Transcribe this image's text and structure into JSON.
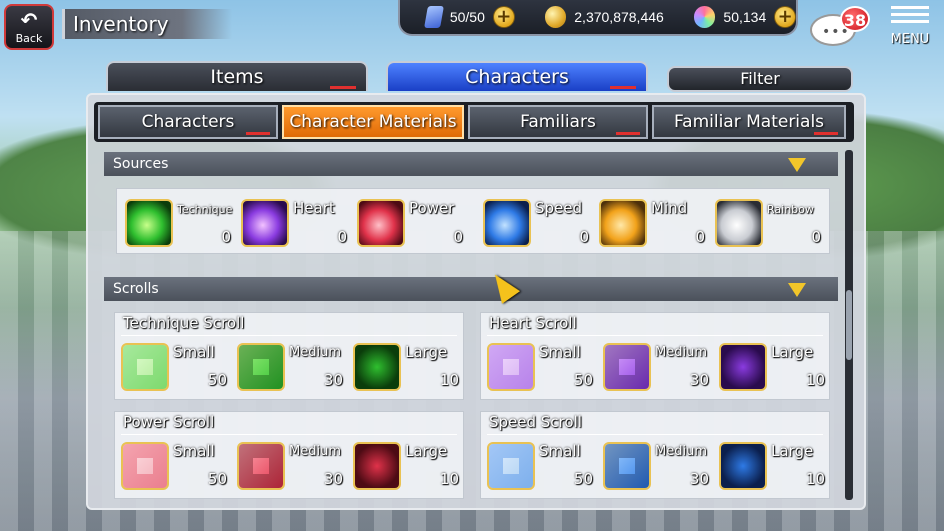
{
  "header": {
    "back_label": "Back",
    "title": "Inventory"
  },
  "resources": {
    "stamina": "50/50",
    "coins": "2,370,878,446",
    "gems": "50,134",
    "plus": "+"
  },
  "chat": {
    "badge": "38"
  },
  "menu_label": "MENU",
  "main_tabs": [
    {
      "label": "Items"
    },
    {
      "label": "Characters"
    }
  ],
  "filter_label": "Filter",
  "sub_tabs": [
    {
      "label": "Characters"
    },
    {
      "label": "Character Materials"
    },
    {
      "label": "Familiars"
    },
    {
      "label": "Familiar Materials"
    }
  ],
  "sources": {
    "title": "Sources",
    "items": [
      {
        "name": "Technique",
        "qty": "0",
        "color": "#2fbf2f"
      },
      {
        "name": "Heart",
        "qty": "0",
        "color": "#8a3be0"
      },
      {
        "name": "Power",
        "qty": "0",
        "color": "#e0324a"
      },
      {
        "name": "Speed",
        "qty": "0",
        "color": "#2e7ae6"
      },
      {
        "name": "Mind",
        "qty": "0",
        "color": "#f2a21a"
      },
      {
        "name": "Rainbow",
        "qty": "0",
        "color": "#c9ccd2"
      }
    ]
  },
  "scrolls": {
    "title": "Scrolls",
    "groups": [
      {
        "title": "Technique Scroll",
        "color": "#2fbf2f",
        "items": [
          {
            "name": "Small",
            "qty": "50"
          },
          {
            "name": "Medium",
            "qty": "30"
          },
          {
            "name": "Large",
            "qty": "10"
          }
        ]
      },
      {
        "title": "Heart Scroll",
        "color": "#8a3be0",
        "items": [
          {
            "name": "Small",
            "qty": "50"
          },
          {
            "name": "Medium",
            "qty": "30"
          },
          {
            "name": "Large",
            "qty": "10"
          }
        ]
      },
      {
        "title": "Power Scroll",
        "color": "#e0324a",
        "items": [
          {
            "name": "Small",
            "qty": "50"
          },
          {
            "name": "Medium",
            "qty": "30"
          },
          {
            "name": "Large",
            "qty": "10"
          }
        ]
      },
      {
        "title": "Speed Scroll",
        "color": "#2e7ae6",
        "items": [
          {
            "name": "Small",
            "qty": "50"
          },
          {
            "name": "Medium",
            "qty": "30"
          },
          {
            "name": "Large",
            "qty": "10"
          }
        ]
      }
    ]
  }
}
